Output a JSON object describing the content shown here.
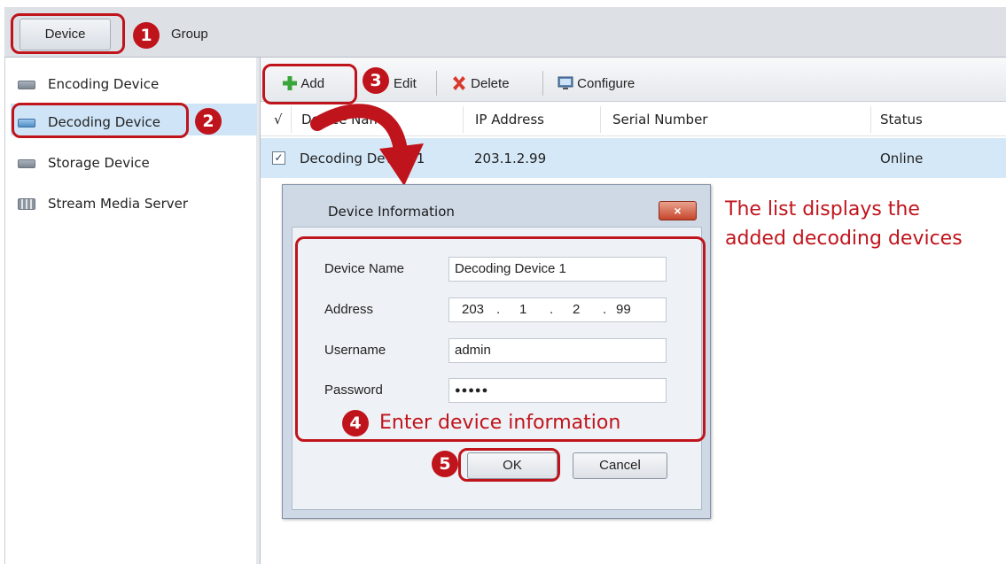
{
  "tabs": {
    "device": "Device",
    "group": "Group"
  },
  "sidebar": {
    "items": [
      {
        "label": "Encoding Device",
        "icon": "encoding-device-icon"
      },
      {
        "label": "Decoding Device",
        "icon": "decoding-device-icon"
      },
      {
        "label": "Storage Device",
        "icon": "storage-device-icon"
      },
      {
        "label": "Stream Media Server",
        "icon": "stream-media-server-icon"
      }
    ]
  },
  "toolbar": {
    "add": "Add",
    "edit": "Edit",
    "delete": "Delete",
    "configure": "Configure"
  },
  "table": {
    "columns": [
      "√",
      "Device Name",
      "IP Address",
      "Serial Number",
      "Status"
    ],
    "rows": [
      {
        "checked": true,
        "device_name": "Decoding Device 1",
        "ip": "203.1.2.99",
        "serial": "",
        "status": "Online"
      }
    ]
  },
  "dialog": {
    "title": "Device Information",
    "close": "×",
    "fields": {
      "device_name_label": "Device Name",
      "device_name_value": "Decoding Device 1",
      "address_label": "Address",
      "address_parts": [
        "203",
        "1",
        "2",
        "99"
      ],
      "username_label": "Username",
      "username_value": "admin",
      "password_label": "Password",
      "password_value": "●●●●●"
    },
    "ok": "OK",
    "cancel": "Cancel"
  },
  "annotations": {
    "steps": [
      "1",
      "2",
      "3",
      "4",
      "5"
    ],
    "note_list_line1": "The list displays the",
    "note_list_line2": "added decoding devices",
    "note_enter": "Enter device information"
  },
  "colors": {
    "annotation_red": "#c0141c",
    "selection_blue": "#d5e8f7",
    "add_green": "#3aa53a",
    "delete_red": "#d8392c"
  }
}
